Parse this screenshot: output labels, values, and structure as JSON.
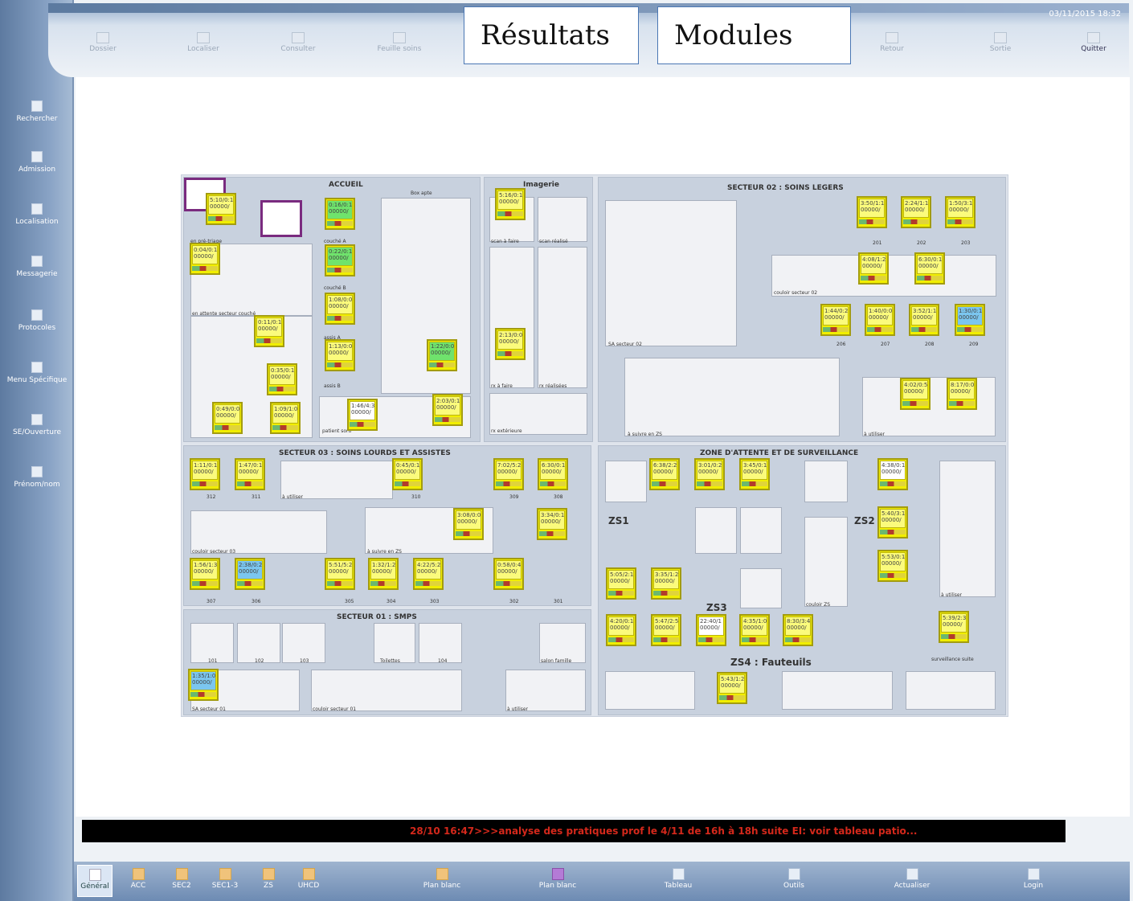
{
  "window": {
    "datetime": "03/11/2015 18:32"
  },
  "toolbar": [
    {
      "label": "Dossier",
      "active": false
    },
    {
      "label": "Localiser",
      "active": false
    },
    {
      "label": "Consulter",
      "active": false
    },
    {
      "label": "Feuille soins",
      "active": false
    },
    {
      "label": "Retour",
      "active": false
    },
    {
      "label": "Sortie",
      "active": false
    },
    {
      "label": "Quitter",
      "active": true
    }
  ],
  "overlay": {
    "results_label": "Résultats",
    "modules_label": "Modules"
  },
  "sidebar": [
    {
      "label": "Rechercher"
    },
    {
      "label": "Admission"
    },
    {
      "label": "Localisation"
    },
    {
      "label": "Messagerie"
    },
    {
      "label": "Protocoles"
    },
    {
      "label": "Menu Spécifique"
    },
    {
      "label": "SE/Ouverture"
    },
    {
      "label": "Prénom/nom"
    }
  ],
  "map": {
    "accueil": {
      "title": "ACCUEIL",
      "subtitle": "Box apte",
      "labels": [
        "en pré-triage",
        "en attente secteur couché",
        "couché A",
        "couché B",
        "assis A",
        "assis B",
        "patient sorti"
      ]
    },
    "imagerie": {
      "title": "Imagerie",
      "labels": [
        "scan à faire",
        "scan réalisé",
        "rx à faire",
        "rx réalisées",
        "rx extérieure"
      ]
    },
    "sec02": {
      "title": "SECTEUR 02 : SOINS LEGERS",
      "rooms": [
        "201",
        "202",
        "203",
        "206",
        "207",
        "208",
        "209"
      ],
      "labels": [
        "SA secteur 02",
        "couloir secteur 02",
        "à suivre en ZS",
        "à utiliser"
      ]
    },
    "sec03": {
      "title": "SECTEUR 03 : SOINS LOURDS ET ASSISTES",
      "rooms": [
        "312",
        "311",
        "310",
        "309",
        "308",
        "307",
        "306",
        "305",
        "304",
        "303",
        "302",
        "301"
      ],
      "labels": [
        "à utiliser",
        "couloir secteur 03",
        "à suivre en ZS"
      ]
    },
    "zas": {
      "title": "ZONE D'ATTENTE ET DE SURVEILLANCE",
      "zones": [
        "ZS1",
        "ZS2",
        "ZS3",
        "ZS4 : Fauteuils"
      ],
      "labels": [
        "couloir ZS",
        "à utiliser",
        "surveillance suite"
      ]
    },
    "sec01": {
      "title": "SECTEUR 01 : SMPS",
      "rooms": [
        "101",
        "102",
        "103",
        "104",
        "Toilettes"
      ],
      "labels": [
        "SA secteur 01",
        "couloir secteur 01",
        "à utiliser",
        "salon famille"
      ]
    },
    "cards": [
      {
        "time": "5:10/0:1",
        "code": "00000/"
      },
      {
        "time": "0:16/0:1",
        "code": "00000/"
      },
      {
        "time": "0:04/0:1",
        "code": "00000/"
      },
      {
        "time": "0:22/0:1",
        "code": "00000/"
      },
      {
        "time": "1:08/0:0",
        "code": "00000/"
      },
      {
        "time": "0:11/0:1",
        "code": "00000/"
      },
      {
        "time": "1:13/0:0",
        "code": "00000/"
      },
      {
        "time": "1:22/0:0",
        "code": "00000/"
      },
      {
        "time": "0:35/0:1",
        "code": "00000/"
      },
      {
        "time": "0:49/0:0",
        "code": "00000/"
      },
      {
        "time": "1:09/1:0",
        "code": "00000/"
      },
      {
        "time": "1:46/4:3",
        "code": "00000/"
      },
      {
        "time": "2:03/0:1",
        "code": "00000/"
      },
      {
        "time": "5:16/0:1",
        "code": "00000/"
      },
      {
        "time": "2:13/0:0",
        "code": "00000/"
      },
      {
        "time": "3:50/1:1",
        "code": "00000/"
      },
      {
        "time": "2:24/1:1",
        "code": "00000/"
      },
      {
        "time": "1:50/3:1",
        "code": "00000/"
      },
      {
        "time": "4:08/1:2",
        "code": "00000/"
      },
      {
        "time": "6:30/0:1",
        "code": "00000/"
      },
      {
        "time": "1:44/0:2",
        "code": "00000/"
      },
      {
        "time": "1:40/0:0",
        "code": "00000/"
      },
      {
        "time": "3:52/1:1",
        "code": "00000/"
      },
      {
        "time": "1:30/0:1",
        "code": "00000/"
      },
      {
        "time": "4:02/0:5",
        "code": "00000/"
      },
      {
        "time": "8:17/0:0",
        "code": "00000/"
      },
      {
        "time": "1:11/0:1",
        "code": "00000/"
      },
      {
        "time": "1:47/0:1",
        "code": "00000/"
      },
      {
        "time": "0:45/0:1",
        "code": "00000/"
      },
      {
        "time": "7:02/5:2",
        "code": "00000/"
      },
      {
        "time": "6:30/0:1",
        "code": "00000/"
      },
      {
        "time": "3:08/0:0",
        "code": "00000/"
      },
      {
        "time": "3:34/0:1",
        "code": "00000/"
      },
      {
        "time": "1:56/1:3",
        "code": "00000/"
      },
      {
        "time": "2:38/0:2",
        "code": "00000/"
      },
      {
        "time": "5:51/5:2",
        "code": "00000/"
      },
      {
        "time": "1:32/1:2",
        "code": "00000/"
      },
      {
        "time": "4:22/5:2",
        "code": "00000/"
      },
      {
        "time": "0:58/0:4",
        "code": "00000/"
      },
      {
        "time": "6:38/2:2",
        "code": "00000/"
      },
      {
        "time": "3:01/0:2",
        "code": "00000/"
      },
      {
        "time": "3:45/0:1",
        "code": "00000/"
      },
      {
        "time": "4:38/0:1",
        "code": "00000/"
      },
      {
        "time": "5:40/3:1",
        "code": "00000/"
      },
      {
        "time": "5:53/0:1",
        "code": "00000/"
      },
      {
        "time": "5:05/2:1",
        "code": "00000/"
      },
      {
        "time": "3:35/1:2",
        "code": "00000/"
      },
      {
        "time": "4:20/0:1",
        "code": "00000/"
      },
      {
        "time": "5:47/2:5",
        "code": "00000/"
      },
      {
        "time": "22:40/1",
        "code": "00000/"
      },
      {
        "time": "4:35/1:0",
        "code": "00000/"
      },
      {
        "time": "8:30/3:4",
        "code": "00000/"
      },
      {
        "time": "5:39/2:3",
        "code": "00000/"
      },
      {
        "time": "5:43/1:2",
        "code": "00000/"
      },
      {
        "time": "1:35/1:0",
        "code": "00000/"
      }
    ]
  },
  "message_bar": {
    "text": "28/10 16:47>>>analyse des pratiques prof le 4/11 de 16h à 18h suite EI: voir tableau patio..."
  },
  "bottombar": [
    {
      "label": "Général",
      "selected": true
    },
    {
      "label": "ACC"
    },
    {
      "label": "SEC2"
    },
    {
      "label": "SEC1-3"
    },
    {
      "label": "ZS"
    },
    {
      "label": "UHCD"
    },
    {
      "label": "Plan blanc"
    },
    {
      "label": "Plan blanc"
    },
    {
      "label": "Tableau"
    },
    {
      "label": "Outils"
    },
    {
      "label": "Actualiser"
    },
    {
      "label": "Login"
    }
  ]
}
